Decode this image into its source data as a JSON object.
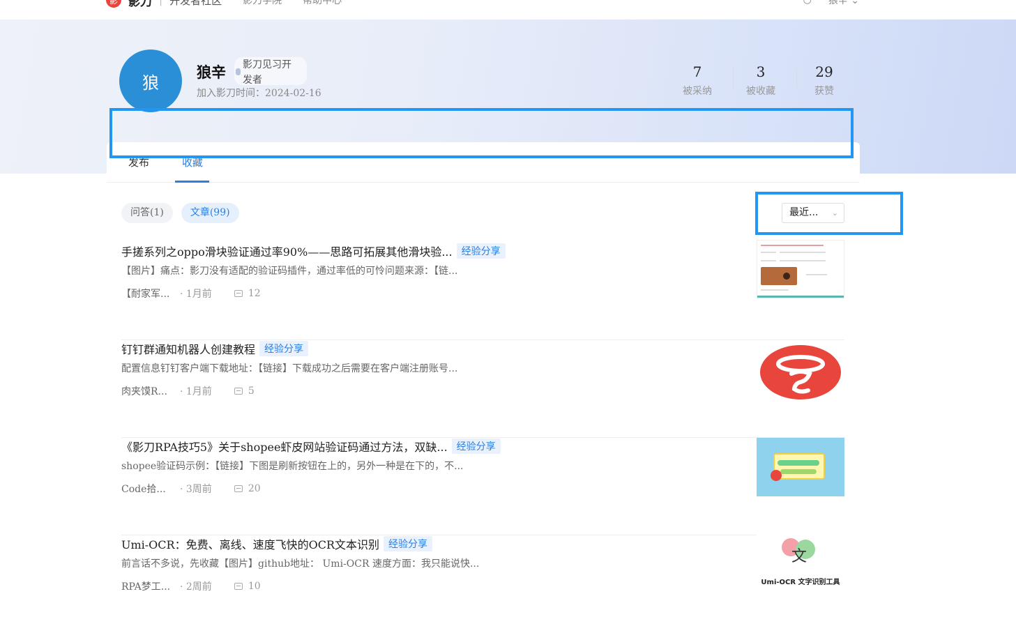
{
  "nav": {
    "brand": "影刀",
    "separator": "|",
    "section": "开发者社区",
    "links": [
      "影刀学院",
      "帮助中心"
    ],
    "user_short": "狼辛"
  },
  "profile": {
    "avatar_char": "狼",
    "name": "狼辛",
    "badge_line1": "影刀见习开",
    "badge_line2": "发者",
    "joined": "加入影刀时间：2024-02-16",
    "stats": [
      {
        "value": "7",
        "label": "被采纳"
      },
      {
        "value": "3",
        "label": "被收藏"
      },
      {
        "value": "29",
        "label": "获赞"
      }
    ]
  },
  "tabs": [
    "发布",
    "收藏"
  ],
  "filters": [
    "问答(1)",
    "文章(99)"
  ],
  "sort": {
    "selected": "最近..."
  },
  "articles": [
    {
      "title": "手搓系列之oppo滑块验证通过率90%——思路可拓展其他滑块验...",
      "tag": "经验分享",
      "summary": "【图片】痛点：影刀没有适配的验证码插件，通过率低的可怜问题来源：【链...",
      "author": "【耐家军...",
      "time": "· 1月前",
      "comments": "12"
    },
    {
      "title": "钉钉群通知机器人创建教程",
      "tag": "经验分享",
      "summary": "配置信息钉钉客户端下载地址：【链接】下载成功之后需要在客户端注册账号...",
      "author": "肉夹馍R...",
      "time": "· 1月前",
      "comments": "5"
    },
    {
      "title": "《影刀RPA技巧5》关于shopee虾皮网站验证码通过方法，双缺...",
      "tag": "经验分享",
      "summary": "shopee验证码示例：【链接】下图是刷新按钮在上的，另外一种是在下的，不...",
      "author": "Code拾...",
      "time": "· 3周前",
      "comments": "20"
    },
    {
      "title": "Umi-OCR：免费、离线、速度飞快的OCR文本识别",
      "tag": "经验分享",
      "summary": "前言话不多说，先收藏【图片】github地址： Umi-OCR 速度方面：我只能说快...",
      "author": "RPA梦工...",
      "time": "· 2周前",
      "comments": "10",
      "thumb_caption": "Umi-OCR 文字识别工具"
    }
  ],
  "colors": {
    "accent": "#2a7fe0",
    "avatar_bg": "#2a8fd6",
    "highlight": "#2196f3",
    "logo_red": "#e8453c"
  }
}
